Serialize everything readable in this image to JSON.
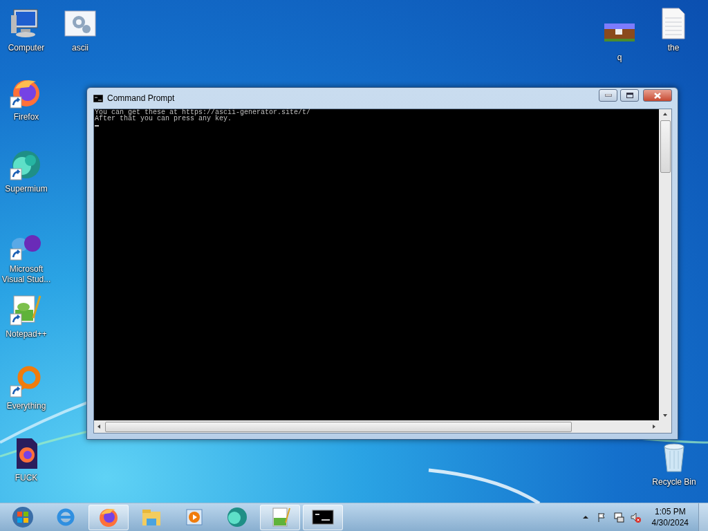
{
  "desktop_icons": [
    {
      "label": "Computer",
      "kind": "computer",
      "shortcut": false
    },
    {
      "label": "ascii",
      "kind": "settings-file",
      "shortcut": false
    },
    {
      "label": "Firefox",
      "kind": "firefox",
      "shortcut": true
    },
    {
      "label": "Supermium",
      "kind": "supermium",
      "shortcut": true
    },
    {
      "label": "Microsoft Visual Stud...",
      "kind": "visual-studio",
      "shortcut": true
    },
    {
      "label": "Notepad++",
      "kind": "notepad",
      "shortcut": true
    },
    {
      "label": "Everything",
      "kind": "everything",
      "shortcut": true
    },
    {
      "label": "FUCK",
      "kind": "firefox-file",
      "shortcut": false
    },
    {
      "label": "q",
      "kind": "image-file",
      "shortcut": false
    },
    {
      "label": "the",
      "kind": "text-file",
      "shortcut": false
    },
    {
      "label": "Recycle Bin",
      "kind": "recycle-bin",
      "shortcut": false
    }
  ],
  "window": {
    "title": "Command Prompt",
    "lines": [
      "You can get these at https://ascii-generator.site/t/",
      "After that you can press any key."
    ],
    "cursor": true
  },
  "taskbar": {
    "items": [
      {
        "kind": "start",
        "open": false
      },
      {
        "kind": "ie",
        "open": false
      },
      {
        "kind": "firefox",
        "open": true
      },
      {
        "kind": "explorer",
        "open": false
      },
      {
        "kind": "media",
        "open": false
      },
      {
        "kind": "supermium",
        "open": false
      },
      {
        "kind": "notepad",
        "open": true
      },
      {
        "kind": "cmd",
        "open": true
      }
    ],
    "tray": {
      "time": "1:05 PM",
      "date": "4/30/2024",
      "volume_muted": true
    }
  }
}
